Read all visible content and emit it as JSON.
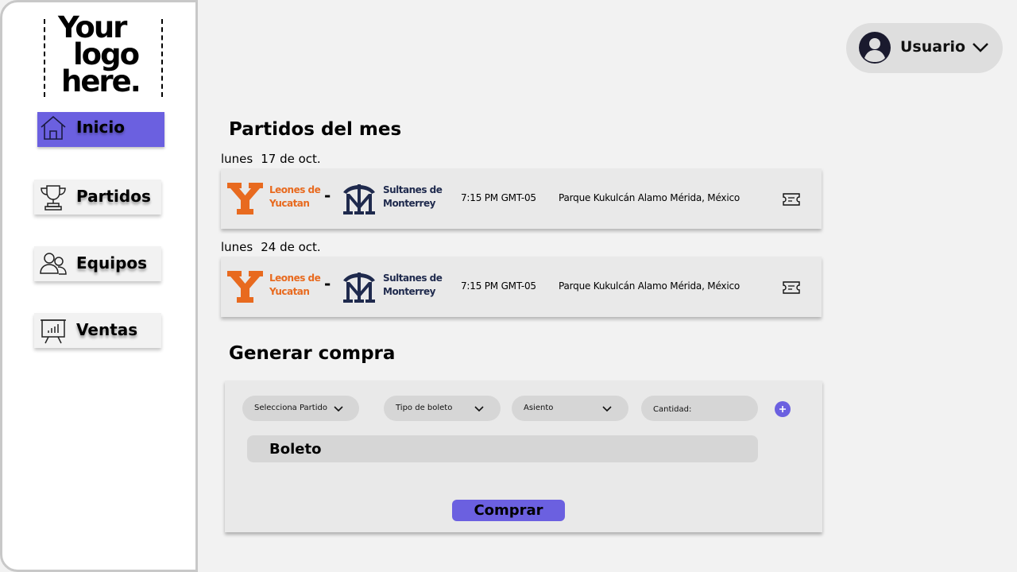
{
  "logo": {
    "lines": [
      "Your",
      "logo",
      "here."
    ]
  },
  "sidebar": {
    "items": [
      {
        "label": "Inicio",
        "icon": "home-icon",
        "active": true
      },
      {
        "label": "Partidos",
        "icon": "trophy-icon",
        "active": false
      },
      {
        "label": "Equipos",
        "icon": "users-icon",
        "active": false
      },
      {
        "label": "Ventas",
        "icon": "presentation-chart-icon",
        "active": false
      }
    ]
  },
  "user": {
    "name": "Usuario",
    "icon": "user-avatar-icon"
  },
  "matches": {
    "title": "Partidos del mes",
    "items": [
      {
        "day": "lunes",
        "date": "17 de oct.",
        "team1": "Leones de Yucatan",
        "separator": "-",
        "team2": "Sultanes de Monterrey",
        "time": "7:15 PM GMT-05",
        "venue": "Parque Kukulcán Alamo Mérida, México"
      },
      {
        "day": "lunes",
        "date": "24 de oct.",
        "team1": "Leones de Yucatan",
        "separator": "-",
        "team2": "Sultanes de Monterrey",
        "time": "7:15 PM GMT-05",
        "venue": "Parque Kukulcán Alamo Mérida, México"
      }
    ]
  },
  "purchase": {
    "title": "Generar compra",
    "match_select": "Selecciona Partido",
    "ticket_type_select": "Tipo de boleto",
    "seat_select": "Asiento",
    "quantity_label": "Cantidad:",
    "ticket_label": "Boleto",
    "buy_label": "Comprar"
  },
  "colors": {
    "accent": "#6b60e0",
    "team1": "#e86a1f",
    "team2": "#1f2a4d",
    "background": "#f2f2f2"
  }
}
